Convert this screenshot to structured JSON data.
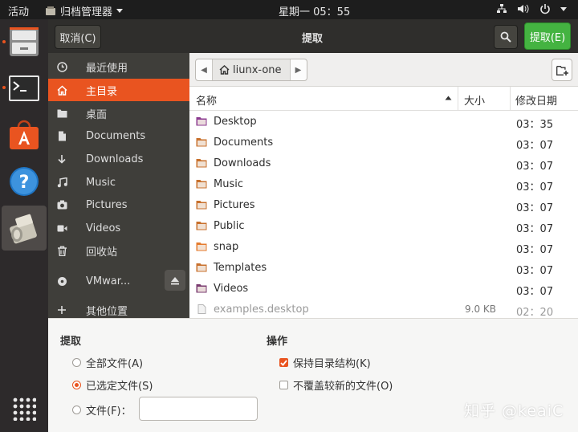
{
  "topbar": {
    "activities": "活动",
    "app_menu": "归档管理器",
    "clock": "星期一 05：55",
    "tray_icons": [
      "network-icon",
      "volume-icon",
      "power-icon"
    ]
  },
  "dock": {
    "items": [
      "file-cabinet",
      "terminal",
      "software-store",
      "help",
      "archive-manager"
    ],
    "show_apps_icon": "grid-icon"
  },
  "header": {
    "cancel": "取消(C)",
    "title": "提取",
    "extract": "提取(E)"
  },
  "sidebar": {
    "items": [
      {
        "icon": "clock-icon",
        "label": "最近使用"
      },
      {
        "icon": "home-icon",
        "label": "主目录"
      },
      {
        "icon": "folder-icon",
        "label": "桌面"
      },
      {
        "icon": "document-icon",
        "label": "Documents"
      },
      {
        "icon": "download-icon",
        "label": "Downloads"
      },
      {
        "icon": "music-icon",
        "label": "Music"
      },
      {
        "icon": "camera-icon",
        "label": "Pictures"
      },
      {
        "icon": "video-icon",
        "label": "Videos"
      },
      {
        "icon": "trash-icon",
        "label": "回收站"
      },
      {
        "icon": "disc-icon",
        "label": "VMwar..."
      },
      {
        "icon": "plus-icon",
        "label": "其他位置"
      }
    ]
  },
  "pathbar": {
    "crumb": "liunx-one"
  },
  "columns": {
    "name": "名称",
    "size": "大小",
    "modified": "修改日期"
  },
  "files": [
    {
      "name": "Desktop",
      "size": "",
      "date": "03：35",
      "color": "#8b3a8f"
    },
    {
      "name": "Documents",
      "size": "",
      "date": "03：07",
      "color": "#c8702c"
    },
    {
      "name": "Downloads",
      "size": "",
      "date": "03：07",
      "color": "#c8702c"
    },
    {
      "name": "Music",
      "size": "",
      "date": "03：07",
      "color": "#c8702c"
    },
    {
      "name": "Pictures",
      "size": "",
      "date": "03：07",
      "color": "#c8702c"
    },
    {
      "name": "Public",
      "size": "",
      "date": "03：07",
      "color": "#c8702c"
    },
    {
      "name": "snap",
      "size": "",
      "date": "03：07",
      "color": "#e57b2e"
    },
    {
      "name": "Templates",
      "size": "",
      "date": "03：07",
      "color": "#c8702c"
    },
    {
      "name": "Videos",
      "size": "",
      "date": "03：07",
      "color": "#7a3b70"
    },
    {
      "name": "examples.desktop",
      "size": "9.0 KB",
      "date": "02：20",
      "color": "#9a9a9a"
    }
  ],
  "options": {
    "extract_title": "提取",
    "all_files": "全部文件(A)",
    "selected_files": "已选定文件(S)",
    "files_label": "文件(F)：",
    "files_value": "",
    "actions_title": "操作",
    "keep_structure": "保持目录结构(K)",
    "no_overwrite": "不覆盖较新的文件(O)",
    "watermark": "知乎 @keaiC"
  }
}
